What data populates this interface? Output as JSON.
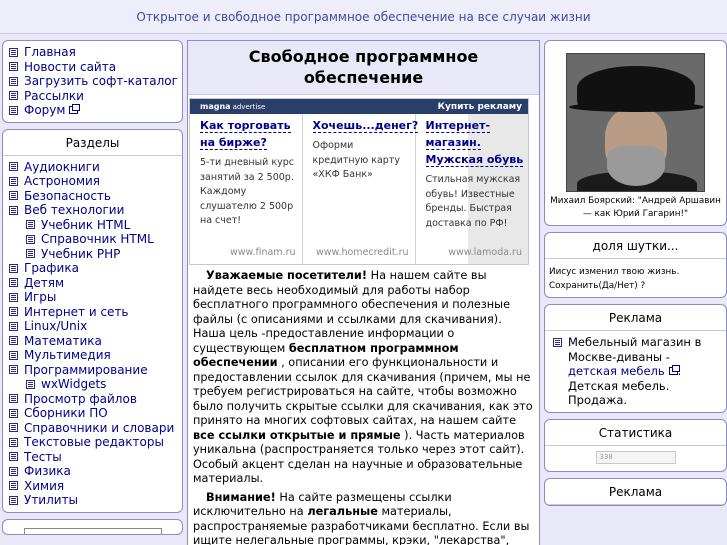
{
  "header": {
    "tagline": "Открытое и свободное программное обеспечение на все случаи жизни"
  },
  "main_nav": [
    {
      "label": "Главная"
    },
    {
      "label": "Новости сайта"
    },
    {
      "label": "Загрузить софт-каталог"
    },
    {
      "label": "Рассылки"
    },
    {
      "label": "Форум",
      "external": true
    }
  ],
  "sections": {
    "title": "Разделы",
    "items": [
      {
        "label": "Аудиокниги"
      },
      {
        "label": "Астрономия"
      },
      {
        "label": "Безопасность"
      },
      {
        "label": "Веб технологии"
      },
      {
        "label": "Учебник HTML",
        "sub": true
      },
      {
        "label": "Справочник HTML",
        "sub": true
      },
      {
        "label": "Учебник PHP",
        "sub": true
      },
      {
        "label": "Графика"
      },
      {
        "label": "Детям"
      },
      {
        "label": "Игры"
      },
      {
        "label": "Интернет и сеть"
      },
      {
        "label": "Linux/Unix"
      },
      {
        "label": "Математика"
      },
      {
        "label": "Мультимедия"
      },
      {
        "label": "Программирование"
      },
      {
        "label": "wxWidgets",
        "sub": true
      },
      {
        "label": "Просмотр файлов"
      },
      {
        "label": "Сборники ПО"
      },
      {
        "label": "Справочники и словари"
      },
      {
        "label": "Текстовые редакторы"
      },
      {
        "label": "Тесты"
      },
      {
        "label": "Физика"
      },
      {
        "label": "Химия"
      },
      {
        "label": "Утилиты"
      }
    ]
  },
  "main": {
    "title": "Свободное программное обеспечение",
    "ad": {
      "logo": "magna",
      "logo_sub": "advertise",
      "buy_label": "Купить рекламу",
      "blocks": [
        {
          "title": "Как торговать на бирже?",
          "text": "5-ти дневный курс занятий за 2 500р. Каждому слушателю 2 500р на счет!",
          "domain": "www.finam.ru"
        },
        {
          "title": "Хочешь...денег?",
          "text": "Оформи кредитную карту «ХКФ Банк»",
          "domain": "www.homecredit.ru"
        },
        {
          "title": "Интернет-магазин. Мужская обувь",
          "text": "Стильная мужская обувь! Известные бренды. Быстрая доставка по РФ!",
          "domain": "www.lamoda.ru"
        }
      ]
    },
    "p1_lead": "Уважаемые посетители!",
    "p1_a": "  На нашем сайте вы найдете весь необходимый для работы набор бесплатного программного обеспечения и полезные файлы (с описаниями и ссылками для скачивания). Наша цель  -предоставление информации о существующем ",
    "p1_bold1": "бесплатном программном обеспечении",
    "p1_b": "     , описании его функциональности и предоставлении ссылок для скачивания (причем, мы не требуем регистрироваться на сайте, чтобы возможно было получить скрытые ссылки для скачивания, как это принято на многих софтовых сайтах, на нашем сайте              ",
    "p1_bold2": "все ссылки открытые и прямые",
    "p1_c": "   ). Часть материалов уникальна (распространяется только через этот сайт). Особый акцент сделан на научные и образовательные материалы.",
    "p2_lead": "Внимание!",
    "p2_a": " На сайте размещены ссылки исключительно на                 ",
    "p2_bold": "легальные",
    "p2_b": " материалы, распространяемые разработчиками бесплатно. Если вы ищите нелегальные программы, крэки, \"лекарства\","
  },
  "right": {
    "photo_caption": "Михаил Боярский: \"Андрей Аршавин — как Юрий Гагарин!\"",
    "jokes_title": "доля шутки...",
    "joke_text": "Иисус изменил твою жизнь. Сохранить(Да/Нет) ?",
    "ads_title": "Реклама",
    "ad_text_a": "Мебельный магазин в Москве-диваны - ",
    "ad_link": "детская мебель",
    "ad_text_b": ". Детская мебель. Продажа.",
    "stats_title": "Статистика",
    "counter_label": "338",
    "ads2_title": "Реклама"
  }
}
